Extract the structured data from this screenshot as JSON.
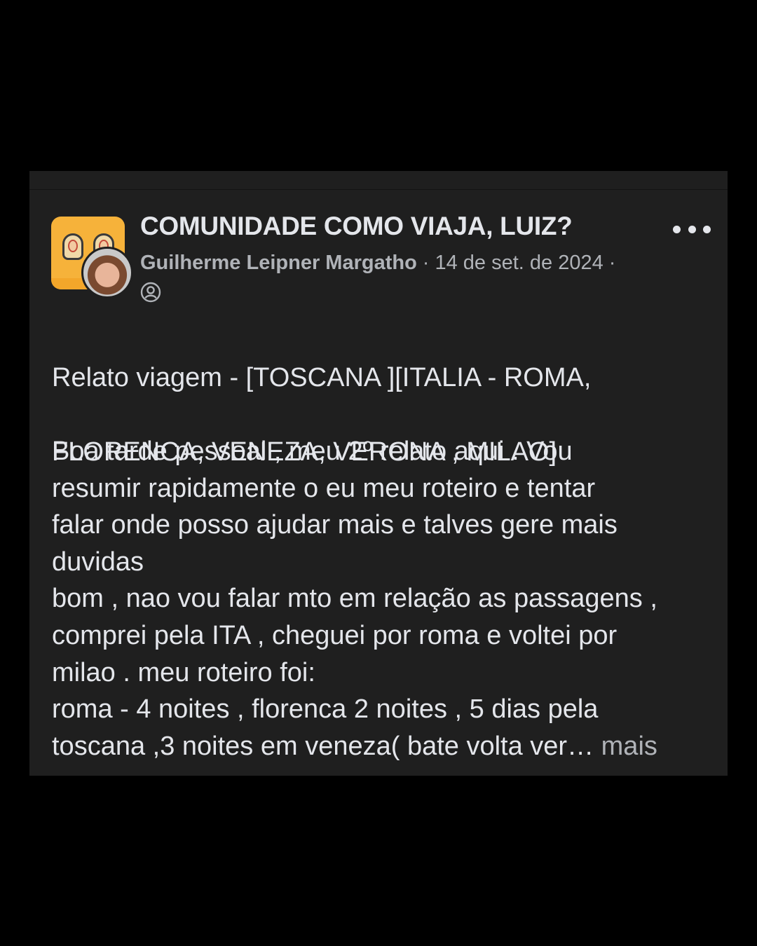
{
  "post": {
    "group_name": "COMUNIDADE COMO VIAJA, LUIZ?",
    "author": "Guilherme Leipner Margatho",
    "separator": "·",
    "date": "14 de set. de 2024",
    "privacy_icon": "group-members-icon",
    "more_icon": "more-options-icon",
    "title_lines": [
      "Relato viagem - [TOSCANA ][ITALIA - ROMA,",
      "FLORENCA, VENEZA, VERONA , MILAO]"
    ],
    "body_lines": [
      "Boa tarde pessoal , meu 2º relato aqui . Vou",
      "resumir rapidamente o eu meu roteiro e tentar",
      "falar onde posso ajudar mais e talves gere mais",
      "duvidas",
      "bom , nao vou falar mto em relação as passagens ,",
      "comprei pela ITA , cheguei por roma e voltei por",
      "milao . meu roteiro foi:",
      "roma - 4 noites , florenca 2 noites , 5 dias pela",
      "toscana ,3 noites em veneza( bate volta ver…"
    ],
    "see_more": "mais"
  },
  "colors": {
    "background": "#000000",
    "card": "#1f1f1f",
    "primary_text": "#e4e6eb",
    "secondary_text": "#b0b3b8",
    "group_avatar": "#f6b23a"
  }
}
